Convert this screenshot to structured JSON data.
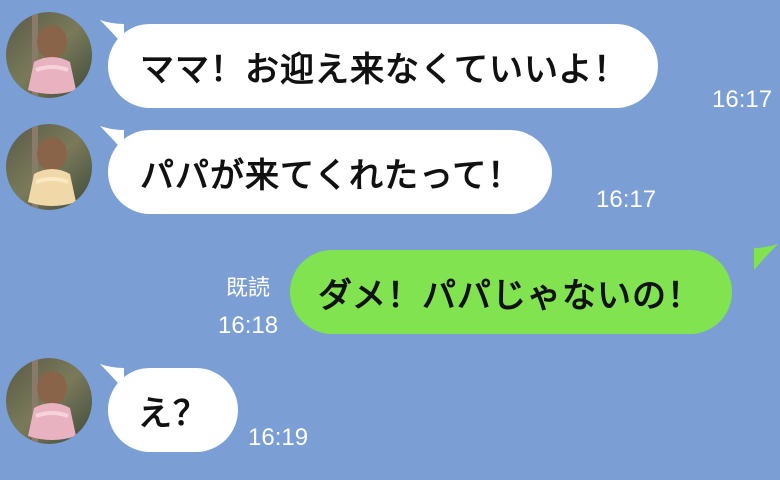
{
  "colors": {
    "background": "#7b9fd4",
    "incoming_bubble": "#ffffff",
    "outgoing_bubble": "#80e34f",
    "meta_text": "#ffffff"
  },
  "messages": [
    {
      "direction": "incoming",
      "text": "ママ！お迎え来なくていいよ！",
      "time": "16:17"
    },
    {
      "direction": "incoming",
      "text": "パパが来てくれたって！",
      "time": "16:17"
    },
    {
      "direction": "outgoing",
      "text": "ダメ！パパじゃないの！",
      "time": "16:18",
      "read_label": "既読"
    },
    {
      "direction": "incoming",
      "text": "え？",
      "time": "16:19"
    }
  ]
}
